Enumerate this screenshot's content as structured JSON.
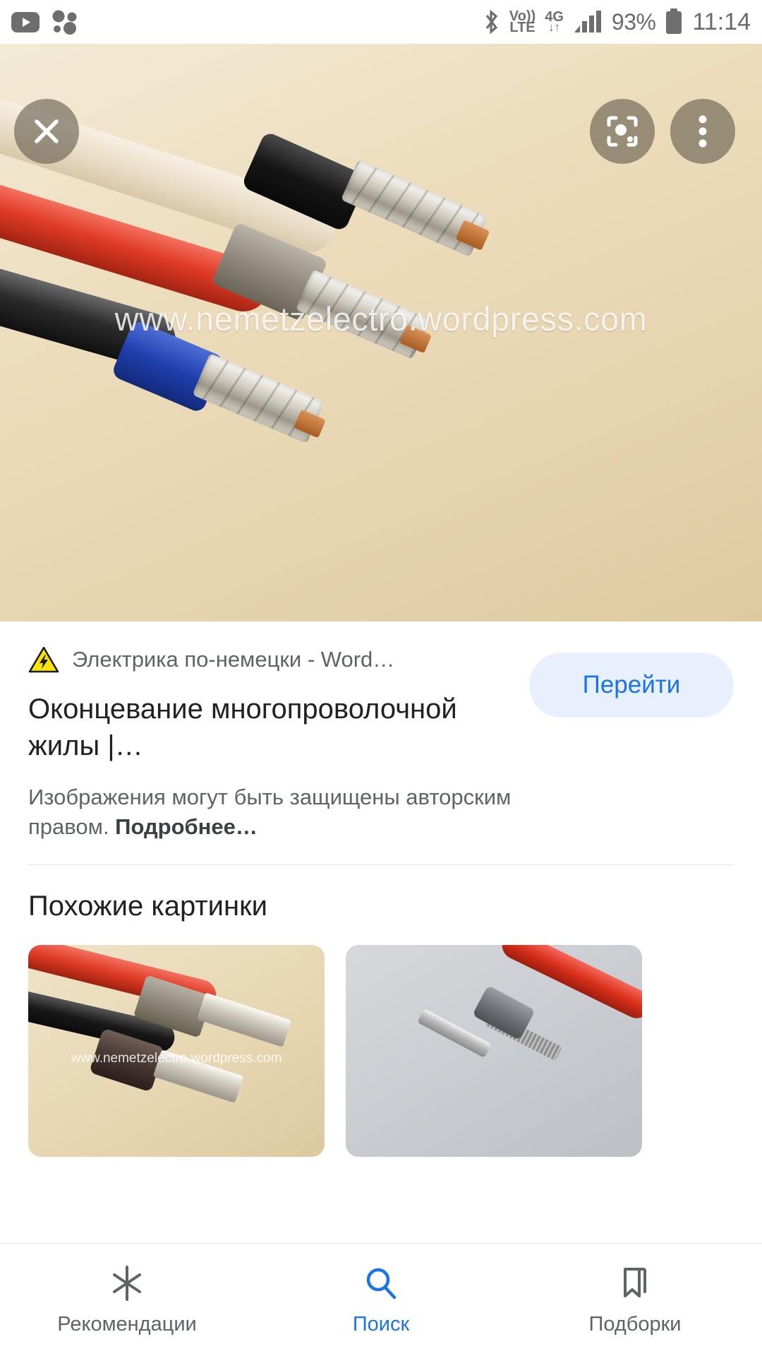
{
  "status_bar": {
    "left_icons": [
      "youtube-icon",
      "google-podcasts-icon"
    ],
    "bluetooth_icon": "bluetooth-icon",
    "volte_top": "Vo))",
    "volte_bottom": "LTE",
    "network_type": "4G",
    "data_arrows": "↓↑",
    "signal_icon": "signal-bars-icon",
    "battery_percent": "93%",
    "battery_icon": "battery-icon",
    "time": "11:14"
  },
  "hero": {
    "watermark": "www.nemetzelectro.wordpress.com",
    "close_icon": "close-icon",
    "lens_icon": "google-lens-icon",
    "more_icon": "more-vertical-icon",
    "alt": "Cable ends with crimped wire ferrules on beige background"
  },
  "result": {
    "favicon": "warning-triangle-icon",
    "source": "Электрика по-немецки - Word…",
    "title": "Оконцевание многопроволочной жилы |…",
    "copyright_text": "Изображения могут быть защищены авторским правом. ",
    "copyright_link": "Подробнее…",
    "go_button": "Перейти"
  },
  "similar": {
    "heading": "Похожие картинки",
    "thumbs": [
      {
        "watermark": "www.nemetzelectro.wordpress.com",
        "alt": "Red and black cables with grey and dark ferrules"
      },
      {
        "watermark": "",
        "alt": "Grey ferrule next to stripped red stranded wire"
      }
    ]
  },
  "bottom_nav": {
    "items": [
      {
        "label": "Рекомендации",
        "icon": "sparkle-icon",
        "active": false
      },
      {
        "label": "Поиск",
        "icon": "search-icon",
        "active": true
      },
      {
        "label": "Подборки",
        "icon": "bookmark-icon",
        "active": false
      }
    ]
  },
  "colors": {
    "accent": "#1a73e8",
    "button_bg": "#e8f0fe",
    "text_primary": "#202124",
    "text_secondary": "#5f6368"
  }
}
